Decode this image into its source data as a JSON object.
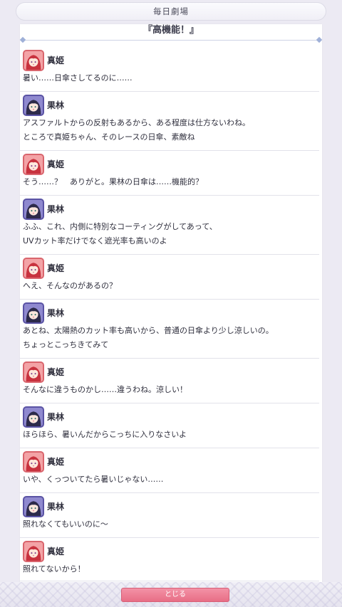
{
  "header": {
    "title": "毎日劇場"
  },
  "story": {
    "title": "『高機能！』"
  },
  "entries": [
    {
      "speaker": "真姫",
      "avatar": "maki",
      "lines": [
        "暑い……日傘さしてるのに……"
      ]
    },
    {
      "speaker": "果林",
      "avatar": "karin",
      "lines": [
        "アスファルトからの反射もあるから、ある程度は仕方ないわね。",
        "ところで真姫ちゃん、そのレースの日傘、素敵ね"
      ]
    },
    {
      "speaker": "真姫",
      "avatar": "maki",
      "lines": [
        "そう……？　ありがと。果林の日傘は……機能的？"
      ]
    },
    {
      "speaker": "果林",
      "avatar": "karin",
      "lines": [
        "ふふ、これ、内側に特別なコーティングがしてあって、",
        "UVカット率だけでなく遮光率も高いのよ"
      ]
    },
    {
      "speaker": "真姫",
      "avatar": "maki",
      "lines": [
        "へえ、そんなのがあるの？"
      ]
    },
    {
      "speaker": "果林",
      "avatar": "karin",
      "lines": [
        "あとね、太陽熱のカット率も高いから、普通の日傘より少し涼しいの。",
        "ちょっとこっちきてみて"
      ]
    },
    {
      "speaker": "真姫",
      "avatar": "maki",
      "lines": [
        "そんなに違うものかし……違うわね。涼しい！"
      ]
    },
    {
      "speaker": "果林",
      "avatar": "karin",
      "lines": [
        "ほらほら、暑いんだからこっちに入りなさいよ"
      ]
    },
    {
      "speaker": "真姫",
      "avatar": "maki",
      "lines": [
        "いや、くっついてたら暑いじゃない……"
      ]
    },
    {
      "speaker": "果林",
      "avatar": "karin",
      "lines": [
        "照れなくてもいいのに～"
      ]
    },
    {
      "speaker": "真姫",
      "avatar": "maki",
      "lines": [
        "照れてないから！"
      ]
    }
  ],
  "footer": {
    "close_label": "とじる"
  }
}
